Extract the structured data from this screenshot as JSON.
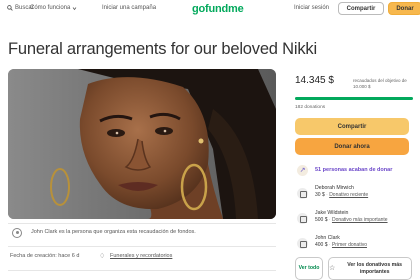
{
  "header": {
    "search_label": "Buscar",
    "how_label": "Cómo funciona",
    "start_label": "Iniciar una campaña",
    "logo": "gofundme",
    "login_label": "Iniciar sesión",
    "share_label": "Compartir",
    "donate_label": "Donar"
  },
  "campaign": {
    "title": "Funeral arrangements for our beloved Nikki",
    "organizer_text": "John Clark es la persona que organiza esta recaudación de fondos.",
    "created_text": "Fecha de creación: hace 6 d",
    "category_label": "Funerales y recordatorios"
  },
  "card": {
    "raised_amount": "14.345 $",
    "raised_text": "recaudados del objetivo de 10.000 $",
    "progress_fraction": 1.0,
    "donations_text": "182 donations",
    "share_label": "Compartir",
    "donate_label": "Donar ahora",
    "trending_text": "51 personas acaban de donar",
    "donors": [
      {
        "name": "Deborah Mirwich",
        "amount": "30 $",
        "tag": "Donativo reciente"
      },
      {
        "name": "Jake Wildstein",
        "amount": "500 $",
        "tag": "Donativo más importante"
      },
      {
        "name": "John Clark",
        "amount": "400 $",
        "tag": "Primer donativo"
      }
    ],
    "see_all_label": "Ver todo",
    "see_top_label": "Ver los donativos más importantes"
  },
  "colors": {
    "brand_green": "#02a95c",
    "share_yellow": "#f7c86a",
    "donate_orange": "#f7a540",
    "trend_purple": "#6b47c9"
  }
}
